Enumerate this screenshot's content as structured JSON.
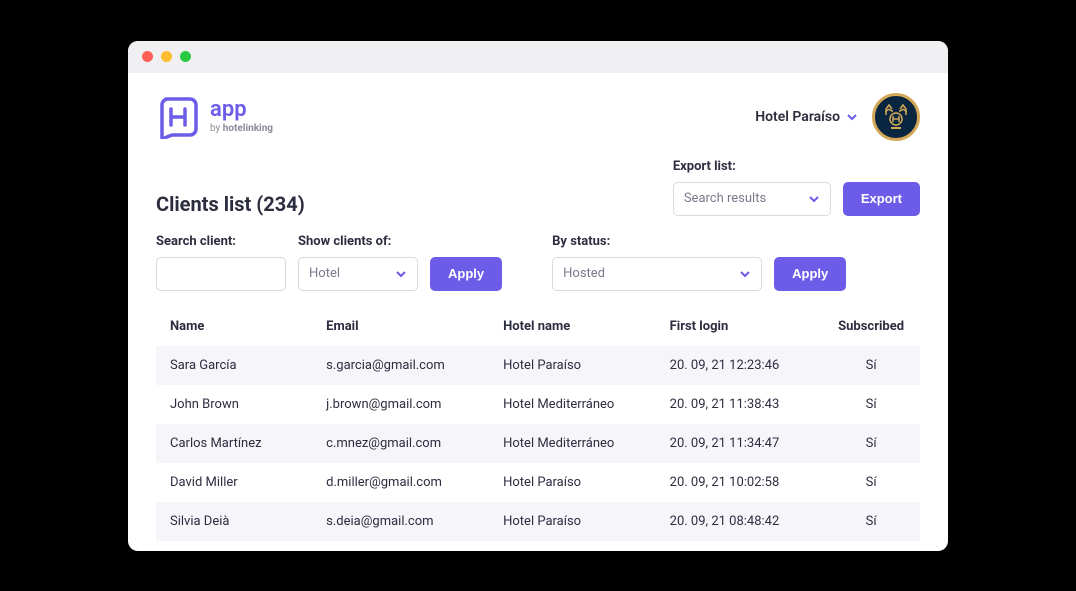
{
  "logo": {
    "title": "app",
    "sub_prefix": "by ",
    "sub_brand": "hotelinking"
  },
  "header": {
    "hotel_selector": "Hotel Paraíso"
  },
  "page_title": "Clients list  (234)",
  "export": {
    "label": "Export list:",
    "select_value": "Search results",
    "button": "Export"
  },
  "filters": {
    "search": {
      "label": "Search client:"
    },
    "show": {
      "label": "Show clients of:",
      "value": "Hotel"
    },
    "apply1": "Apply",
    "status": {
      "label": "By status:",
      "value": "Hosted"
    },
    "apply2": "Apply"
  },
  "table": {
    "headers": {
      "name": "Name",
      "email": "Email",
      "hotel": "Hotel name",
      "login": "First login",
      "subscribed": "Subscribed"
    },
    "rows": [
      {
        "name": "Sara García",
        "email": "s.garcia@gmail.com",
        "hotel": "Hotel Paraíso",
        "login": "20. 09, 21 12:23:46",
        "subscribed": "Sí"
      },
      {
        "name": "John Brown",
        "email": "j.brown@gmail.com",
        "hotel": "Hotel Mediterráneo",
        "login": "20. 09, 21 11:38:43",
        "subscribed": "Sí"
      },
      {
        "name": "Carlos Martínez",
        "email": "c.mnez@gmail.com",
        "hotel": "Hotel Mediterráneo",
        "login": "20. 09, 21 11:34:47",
        "subscribed": "Sí"
      },
      {
        "name": "David Miller",
        "email": "d.miller@gmail.com",
        "hotel": "Hotel Paraíso",
        "login": "20. 09, 21 10:02:58",
        "subscribed": "Sí"
      },
      {
        "name": "Silvia Deià",
        "email": "s.deia@gmail.com",
        "hotel": "Hotel Paraíso",
        "login": "20. 09, 21 08:48:42",
        "subscribed": "Sí"
      }
    ]
  }
}
